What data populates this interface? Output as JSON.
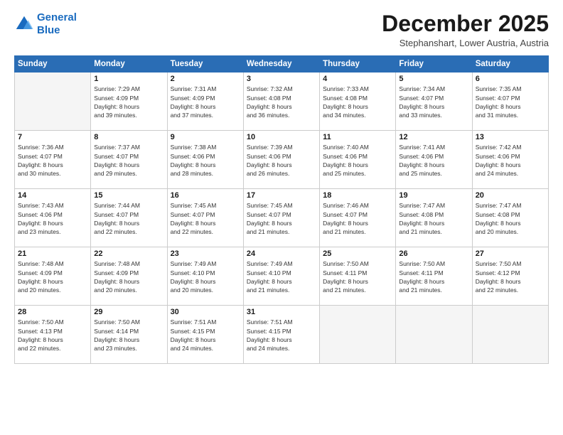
{
  "logo": {
    "line1": "General",
    "line2": "Blue"
  },
  "title": "December 2025",
  "subtitle": "Stephanshart, Lower Austria, Austria",
  "days_header": [
    "Sunday",
    "Monday",
    "Tuesday",
    "Wednesday",
    "Thursday",
    "Friday",
    "Saturday"
  ],
  "weeks": [
    [
      {
        "day": "",
        "info": ""
      },
      {
        "day": "1",
        "info": "Sunrise: 7:29 AM\nSunset: 4:09 PM\nDaylight: 8 hours\nand 39 minutes."
      },
      {
        "day": "2",
        "info": "Sunrise: 7:31 AM\nSunset: 4:09 PM\nDaylight: 8 hours\nand 37 minutes."
      },
      {
        "day": "3",
        "info": "Sunrise: 7:32 AM\nSunset: 4:08 PM\nDaylight: 8 hours\nand 36 minutes."
      },
      {
        "day": "4",
        "info": "Sunrise: 7:33 AM\nSunset: 4:08 PM\nDaylight: 8 hours\nand 34 minutes."
      },
      {
        "day": "5",
        "info": "Sunrise: 7:34 AM\nSunset: 4:07 PM\nDaylight: 8 hours\nand 33 minutes."
      },
      {
        "day": "6",
        "info": "Sunrise: 7:35 AM\nSunset: 4:07 PM\nDaylight: 8 hours\nand 31 minutes."
      }
    ],
    [
      {
        "day": "7",
        "info": "Sunrise: 7:36 AM\nSunset: 4:07 PM\nDaylight: 8 hours\nand 30 minutes."
      },
      {
        "day": "8",
        "info": "Sunrise: 7:37 AM\nSunset: 4:07 PM\nDaylight: 8 hours\nand 29 minutes."
      },
      {
        "day": "9",
        "info": "Sunrise: 7:38 AM\nSunset: 4:06 PM\nDaylight: 8 hours\nand 28 minutes."
      },
      {
        "day": "10",
        "info": "Sunrise: 7:39 AM\nSunset: 4:06 PM\nDaylight: 8 hours\nand 26 minutes."
      },
      {
        "day": "11",
        "info": "Sunrise: 7:40 AM\nSunset: 4:06 PM\nDaylight: 8 hours\nand 25 minutes."
      },
      {
        "day": "12",
        "info": "Sunrise: 7:41 AM\nSunset: 4:06 PM\nDaylight: 8 hours\nand 25 minutes."
      },
      {
        "day": "13",
        "info": "Sunrise: 7:42 AM\nSunset: 4:06 PM\nDaylight: 8 hours\nand 24 minutes."
      }
    ],
    [
      {
        "day": "14",
        "info": "Sunrise: 7:43 AM\nSunset: 4:06 PM\nDaylight: 8 hours\nand 23 minutes."
      },
      {
        "day": "15",
        "info": "Sunrise: 7:44 AM\nSunset: 4:07 PM\nDaylight: 8 hours\nand 22 minutes."
      },
      {
        "day": "16",
        "info": "Sunrise: 7:45 AM\nSunset: 4:07 PM\nDaylight: 8 hours\nand 22 minutes."
      },
      {
        "day": "17",
        "info": "Sunrise: 7:45 AM\nSunset: 4:07 PM\nDaylight: 8 hours\nand 21 minutes."
      },
      {
        "day": "18",
        "info": "Sunrise: 7:46 AM\nSunset: 4:07 PM\nDaylight: 8 hours\nand 21 minutes."
      },
      {
        "day": "19",
        "info": "Sunrise: 7:47 AM\nSunset: 4:08 PM\nDaylight: 8 hours\nand 21 minutes."
      },
      {
        "day": "20",
        "info": "Sunrise: 7:47 AM\nSunset: 4:08 PM\nDaylight: 8 hours\nand 20 minutes."
      }
    ],
    [
      {
        "day": "21",
        "info": "Sunrise: 7:48 AM\nSunset: 4:09 PM\nDaylight: 8 hours\nand 20 minutes."
      },
      {
        "day": "22",
        "info": "Sunrise: 7:48 AM\nSunset: 4:09 PM\nDaylight: 8 hours\nand 20 minutes."
      },
      {
        "day": "23",
        "info": "Sunrise: 7:49 AM\nSunset: 4:10 PM\nDaylight: 8 hours\nand 20 minutes."
      },
      {
        "day": "24",
        "info": "Sunrise: 7:49 AM\nSunset: 4:10 PM\nDaylight: 8 hours\nand 21 minutes."
      },
      {
        "day": "25",
        "info": "Sunrise: 7:50 AM\nSunset: 4:11 PM\nDaylight: 8 hours\nand 21 minutes."
      },
      {
        "day": "26",
        "info": "Sunrise: 7:50 AM\nSunset: 4:11 PM\nDaylight: 8 hours\nand 21 minutes."
      },
      {
        "day": "27",
        "info": "Sunrise: 7:50 AM\nSunset: 4:12 PM\nDaylight: 8 hours\nand 22 minutes."
      }
    ],
    [
      {
        "day": "28",
        "info": "Sunrise: 7:50 AM\nSunset: 4:13 PM\nDaylight: 8 hours\nand 22 minutes."
      },
      {
        "day": "29",
        "info": "Sunrise: 7:50 AM\nSunset: 4:14 PM\nDaylight: 8 hours\nand 23 minutes."
      },
      {
        "day": "30",
        "info": "Sunrise: 7:51 AM\nSunset: 4:15 PM\nDaylight: 8 hours\nand 24 minutes."
      },
      {
        "day": "31",
        "info": "Sunrise: 7:51 AM\nSunset: 4:15 PM\nDaylight: 8 hours\nand 24 minutes."
      },
      {
        "day": "",
        "info": ""
      },
      {
        "day": "",
        "info": ""
      },
      {
        "day": "",
        "info": ""
      }
    ]
  ]
}
